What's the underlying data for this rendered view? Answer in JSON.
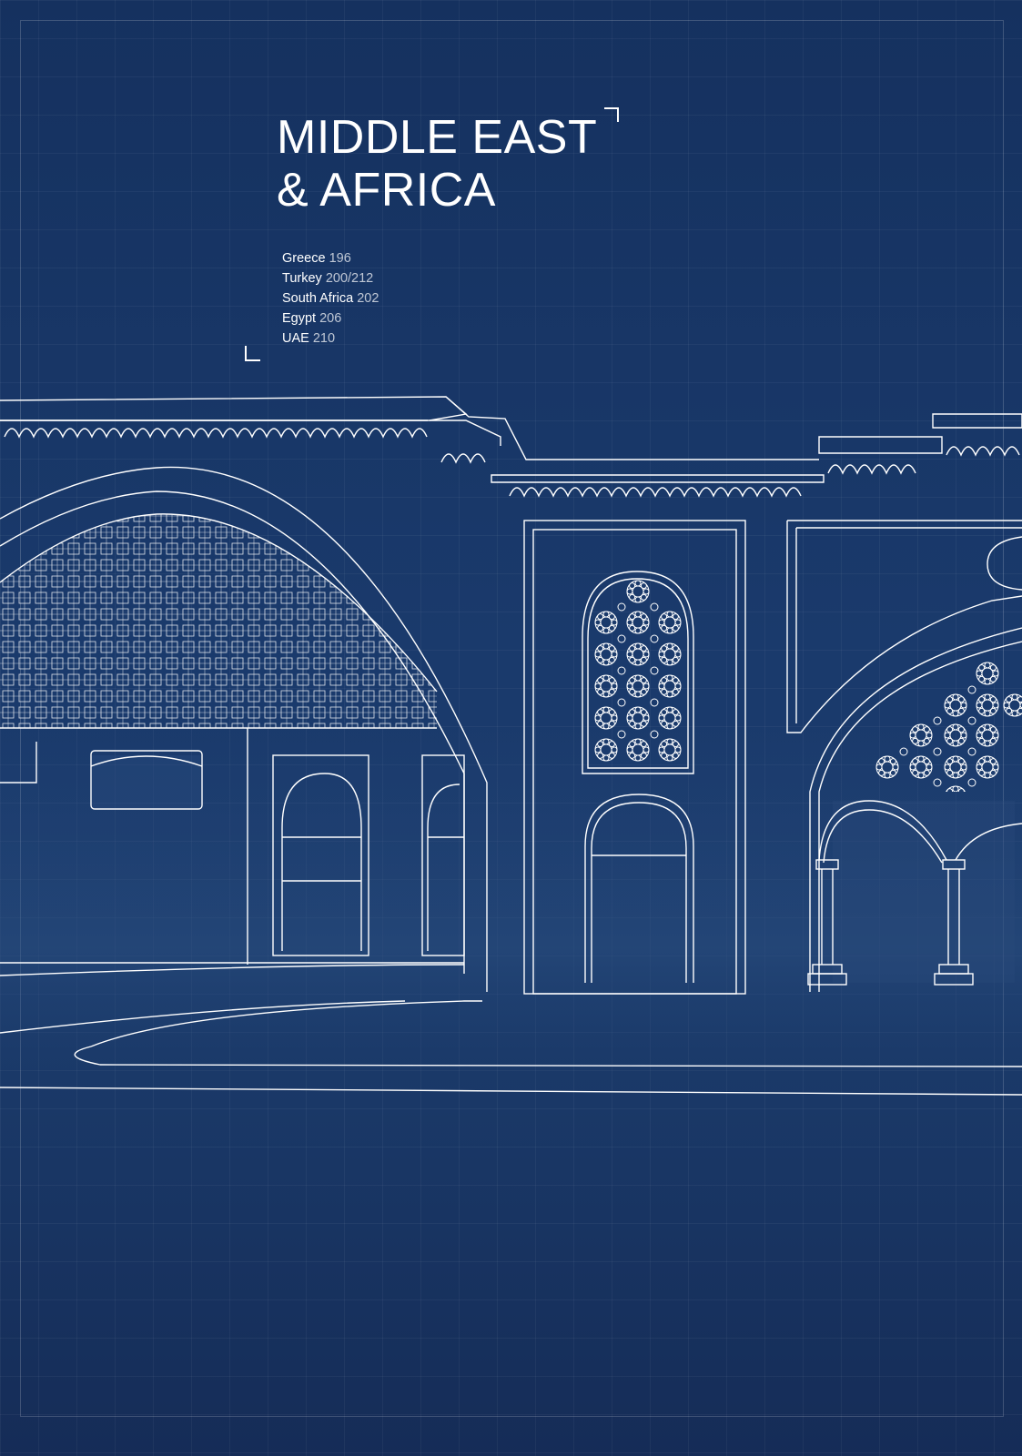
{
  "heading": {
    "line1": "MIDDLE EAST",
    "line2": "& AFRICA"
  },
  "toc": [
    {
      "country": "Greece",
      "pages": "196"
    },
    {
      "country": "Turkey",
      "pages": "200/212"
    },
    {
      "country": "South Africa",
      "pages": "202"
    },
    {
      "country": "Egypt",
      "pages": "206"
    },
    {
      "country": "UAE",
      "pages": "210"
    }
  ],
  "colors": {
    "background": "#163466",
    "lines": "#ffffff"
  }
}
